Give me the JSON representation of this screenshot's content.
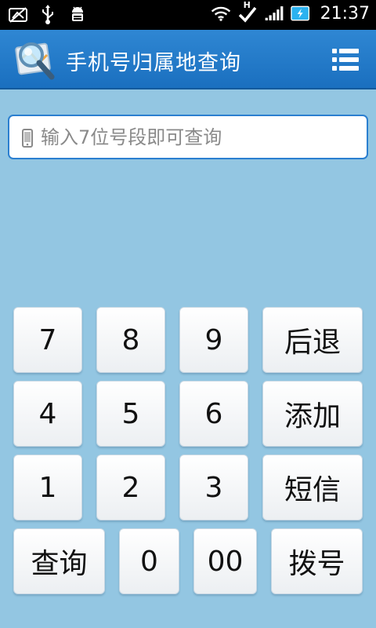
{
  "status_bar": {
    "time": "21:37",
    "icons": [
      "gallery-icon",
      "usb-icon",
      "android-debug-icon",
      "wifi-icon",
      "download-check-icon",
      "signal-icon",
      "battery-charging-icon"
    ],
    "hsdpa_label": "H"
  },
  "header": {
    "title": "手机号归属地查询",
    "logo_icon": "magnifier-map-icon",
    "menu_icon": "list-menu-icon",
    "accent_color": "#1f76c8"
  },
  "search": {
    "placeholder": "输入7位号段即可查询",
    "value": "",
    "icon": "phone-icon"
  },
  "keypad": {
    "row1": [
      "7",
      "8",
      "9",
      "后退"
    ],
    "row2": [
      "4",
      "5",
      "6",
      "添加"
    ],
    "row3": [
      "1",
      "2",
      "3",
      "短信"
    ],
    "row4": [
      "查询",
      "0",
      "00",
      "拨号"
    ]
  },
  "colors": {
    "background": "#93c6e2",
    "key_face": "#ffffff"
  }
}
